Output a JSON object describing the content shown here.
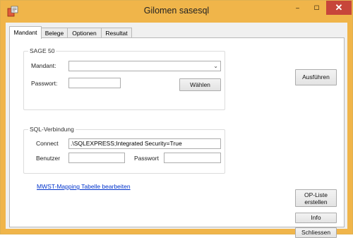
{
  "window": {
    "title": "Gilomen sasesql",
    "min_label": "–",
    "max_label": "☐",
    "close_label": "✕"
  },
  "tabs": [
    {
      "label": "Mandant",
      "active": true
    },
    {
      "label": "Belege",
      "active": false
    },
    {
      "label": "Optionen",
      "active": false
    },
    {
      "label": "Resultat",
      "active": false
    }
  ],
  "sage": {
    "legend": "SAGE 50",
    "mandant_label": "Mandant:",
    "mandant_value": "",
    "passwort_label": "Passwort:",
    "passwort_value": "",
    "waehlen_label": "Wählen"
  },
  "sql": {
    "legend": "SQL-Verbindung",
    "connect_label": "Connect",
    "connect_value": ".\\SQLEXPRESS;Integrated Security=True",
    "benutzer_label": "Benutzer",
    "benutzer_value": "",
    "passwort_label": "Passwort",
    "passwort_value": ""
  },
  "link": {
    "mwst_label": "MWST-Mapping Tabelle bearbeiten"
  },
  "buttons": {
    "ausfuehren": "Ausführen",
    "opliste_line1": "OP-Liste",
    "opliste_line2": "erstellen",
    "info": "Info",
    "schliessen": "Schliessen"
  },
  "icons": {
    "app": "app-icon",
    "select": "chevron-down-icon"
  },
  "colors": {
    "titlebar": "#f0b54a",
    "close": "#c7463a",
    "link": "#0033cc"
  }
}
